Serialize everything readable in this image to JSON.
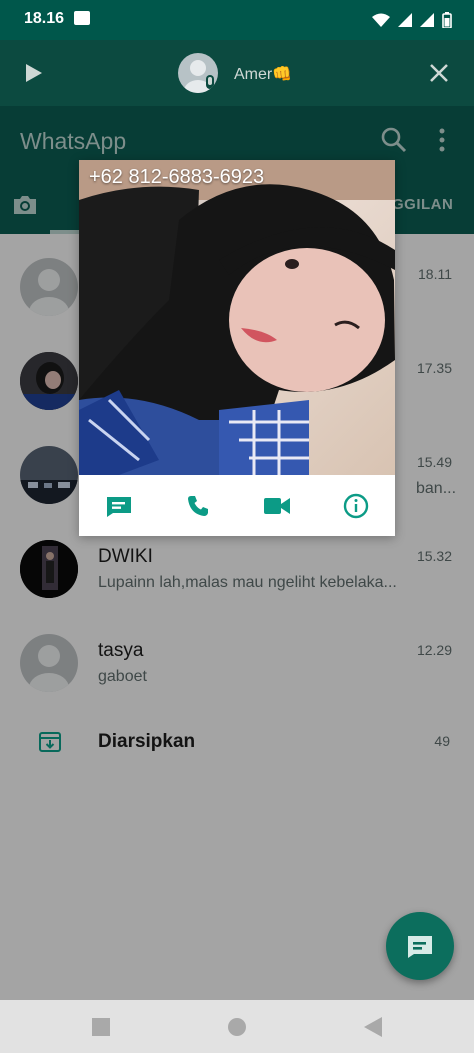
{
  "status_bar": {
    "time": "18.16"
  },
  "voice_bar": {
    "contact_name": "Amer👊"
  },
  "header": {
    "title": "WhatsApp",
    "calls_tab_label": "GGILAN"
  },
  "chats": [
    {
      "name": "",
      "preview": "",
      "time": "18.11"
    },
    {
      "name": "",
      "preview": "",
      "time": "17.35"
    },
    {
      "name": "",
      "preview": "ban...",
      "time": "15.49"
    },
    {
      "name": "DWIKI",
      "preview": "Lupainn lah,malas mau ngeliht kebelaka...",
      "time": "15.32"
    },
    {
      "name": "tasya",
      "preview": "gaboet",
      "time": "12.29"
    }
  ],
  "archive": {
    "label": "Diarsipkan",
    "count": "49"
  },
  "profile_popup": {
    "phone_number": "+62 812-6883-6923",
    "actions": [
      "message-icon",
      "phone-icon",
      "video-icon",
      "info-icon"
    ]
  },
  "colors": {
    "accent": "#0c9b86",
    "header": "#0b5b50",
    "status": "#00574b"
  }
}
